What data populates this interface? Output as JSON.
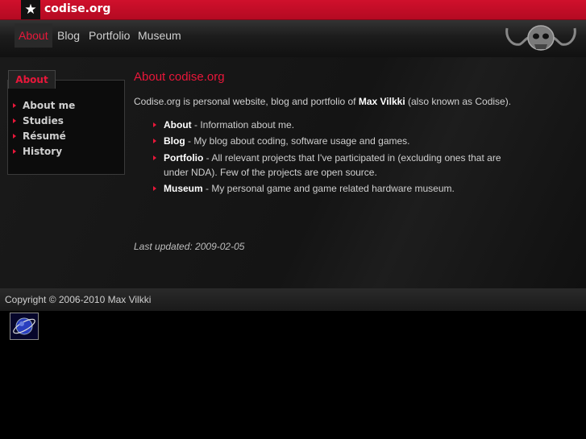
{
  "header": {
    "logo_glyph": "★",
    "site_name": "codise.org"
  },
  "nav": {
    "items": [
      {
        "label": "About",
        "active": true
      },
      {
        "label": "Blog",
        "active": false
      },
      {
        "label": "Portfolio",
        "active": false
      },
      {
        "label": "Museum",
        "active": false
      }
    ]
  },
  "sidebar": {
    "tab_label": "About",
    "items": [
      {
        "label": "About me"
      },
      {
        "label": "Studies"
      },
      {
        "label": "Résumé"
      },
      {
        "label": "History"
      }
    ]
  },
  "content": {
    "title": "About codise.org",
    "intro_before": "Codise.org is personal website, blog and portfolio of ",
    "intro_name": "Max Vilkki",
    "intro_after": " (also known as Codise).",
    "bullets": [
      {
        "term": "About",
        "desc": " - Information about me."
      },
      {
        "term": "Blog",
        "desc": " - My blog about coding, software usage and games."
      },
      {
        "term": "Portfolio",
        "desc": " - All relevant projects that I've participated in (excluding ones that are under NDA). Few of the projects are open source."
      },
      {
        "term": "Museum",
        "desc": " - My personal game and game related hardware museum."
      }
    ],
    "last_updated": "Last updated: 2009-02-05"
  },
  "footer": {
    "copyright": "Copyright © 2006-2010 Max Vilkki"
  },
  "colors": {
    "accent": "#e8173a",
    "topbar": "#c70d27"
  },
  "icons": {
    "logo": "star-logo-icon",
    "mascot": "skull-mascot-icon",
    "badge": "planet-badge-icon"
  }
}
